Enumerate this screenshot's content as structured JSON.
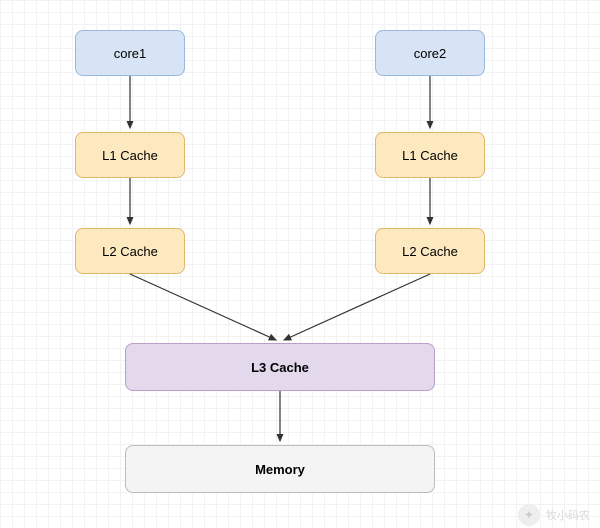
{
  "nodes": {
    "core1": "core1",
    "core2": "core2",
    "l1a": "L1 Cache",
    "l1b": "L1 Cache",
    "l2a": "L2 Cache",
    "l2b": "L2 Cache",
    "l3": "L3 Cache",
    "memory": "Memory"
  },
  "edges": [
    [
      "core1",
      "l1a"
    ],
    [
      "l1a",
      "l2a"
    ],
    [
      "l2a",
      "l3"
    ],
    [
      "core2",
      "l1b"
    ],
    [
      "l1b",
      "l2b"
    ],
    [
      "l2b",
      "l3"
    ],
    [
      "l3",
      "memory"
    ]
  ],
  "watermark": {
    "author": "牧小码农",
    "icon": "✦"
  }
}
